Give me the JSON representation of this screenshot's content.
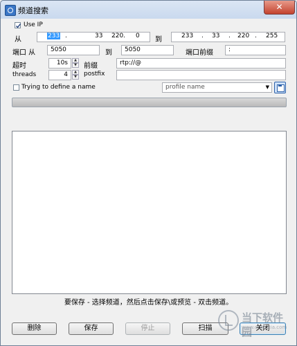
{
  "window": {
    "title": "频道搜索",
    "close_glyph": "✕"
  },
  "use_ip": {
    "label": "Use IP",
    "checked": true
  },
  "from_label": "从",
  "to_label": "到",
  "ip_from": [
    "233",
    "33",
    "220",
    "0"
  ],
  "ip_to": [
    "233",
    "33",
    "220",
    "255"
  ],
  "ip_sep": ".",
  "port": {
    "label": "端口 从",
    "from": "5050",
    "to_label": "到",
    "to": "5050",
    "prefix_label": "端口前缀",
    "prefix_value": ":"
  },
  "timeout": {
    "label": "超时",
    "value": "10s"
  },
  "prefix": {
    "label": "前缀",
    "value": "rtp://@"
  },
  "threads": {
    "label": "threads",
    "value": "4"
  },
  "postfix": {
    "label": "postfix",
    "value": ""
  },
  "name_option": {
    "label": "Trying to define a name",
    "checked": false
  },
  "profile": {
    "value": "profile name"
  },
  "hint": "要保存 - 选择频道，然后点击保存\\或预览 - 双击频道。",
  "buttons": {
    "delete": "删除",
    "save": "保存",
    "stop": "停止",
    "scan": "扫描",
    "close": "关闭"
  },
  "spin_up": "▲",
  "spin_down": "▼",
  "watermark": {
    "text": "当下软件园",
    "url": "www.downxia.com"
  }
}
